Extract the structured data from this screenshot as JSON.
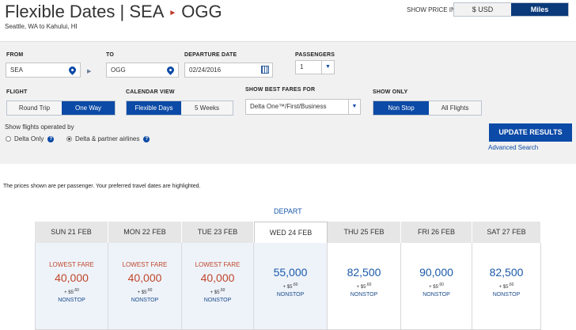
{
  "header": {
    "title_prefix": "Flexible Dates |",
    "origin": "SEA",
    "destination": "OGG",
    "subtitle": "Seattle, WA to Kahului, HI",
    "price_label": "SHOW PRICE IN",
    "price_options": [
      "$ USD",
      "Miles"
    ],
    "selected_price": "Miles"
  },
  "form": {
    "from_label": "FROM",
    "from_value": "SEA",
    "to_label": "TO",
    "to_value": "OGG",
    "departure_label": "DEPARTURE DATE",
    "departure_value": "02/24/2016",
    "passengers_label": "PASSENGERS",
    "passengers_value": "1",
    "flight_label": "FLIGHT",
    "flight_options": [
      "Round Trip",
      "One Way"
    ],
    "flight_selected": "One Way",
    "calendar_label": "CALENDAR VIEW",
    "calendar_options": [
      "Flexible Days",
      "5 Weeks"
    ],
    "calendar_selected": "Flexible Days",
    "best_fares_label": "SHOW BEST FARES FOR",
    "best_fares_value": "Delta One™/First/Business",
    "show_only_label": "SHOW ONLY",
    "show_only_options": [
      "Non Stop",
      "All Flights"
    ],
    "show_only_selected": "Non Stop",
    "operated_label": "Show flights operated by",
    "operated_options": [
      "Delta Only",
      "Delta & partner airlines"
    ],
    "operated_selected": "Delta & partner airlines",
    "update_button": "UPDATE RESULTS",
    "advanced_link": "Advanced Search"
  },
  "results": {
    "note": "The prices shown are per passenger. Your preferred travel dates are highlighted.",
    "depart_label": "DEPART",
    "tax_prefix": "+ $",
    "tax_whole": "5",
    "tax_cents": ".60",
    "days": [
      {
        "day": "SUN 21 FEB",
        "lowest": "LOWEST FARE",
        "amount": "40,000",
        "stop": "NONSTOP"
      },
      {
        "day": "MON 22 FEB",
        "lowest": "LOWEST FARE",
        "amount": "40,000",
        "stop": "NONSTOP"
      },
      {
        "day": "TUE 23 FEB",
        "lowest": "LOWEST FARE",
        "amount": "40,000",
        "stop": "NONSTOP"
      },
      {
        "day": "WED 24 FEB",
        "lowest": "",
        "amount": "55,000",
        "stop": "NONSTOP",
        "selected": true
      },
      {
        "day": "THU 25 FEB",
        "lowest": "",
        "amount": "82,500",
        "stop": "NONSTOP"
      },
      {
        "day": "FRI 26 FEB",
        "lowest": "",
        "amount": "90,000",
        "stop": "NONSTOP"
      },
      {
        "day": "SAT 27 FEB",
        "lowest": "",
        "amount": "82,500",
        "stop": "NONSTOP"
      }
    ]
  },
  "colors": {
    "accent": "#0b4aa6",
    "lowest_fare": "#c0462a",
    "regular_fare": "#1a5aa8"
  }
}
